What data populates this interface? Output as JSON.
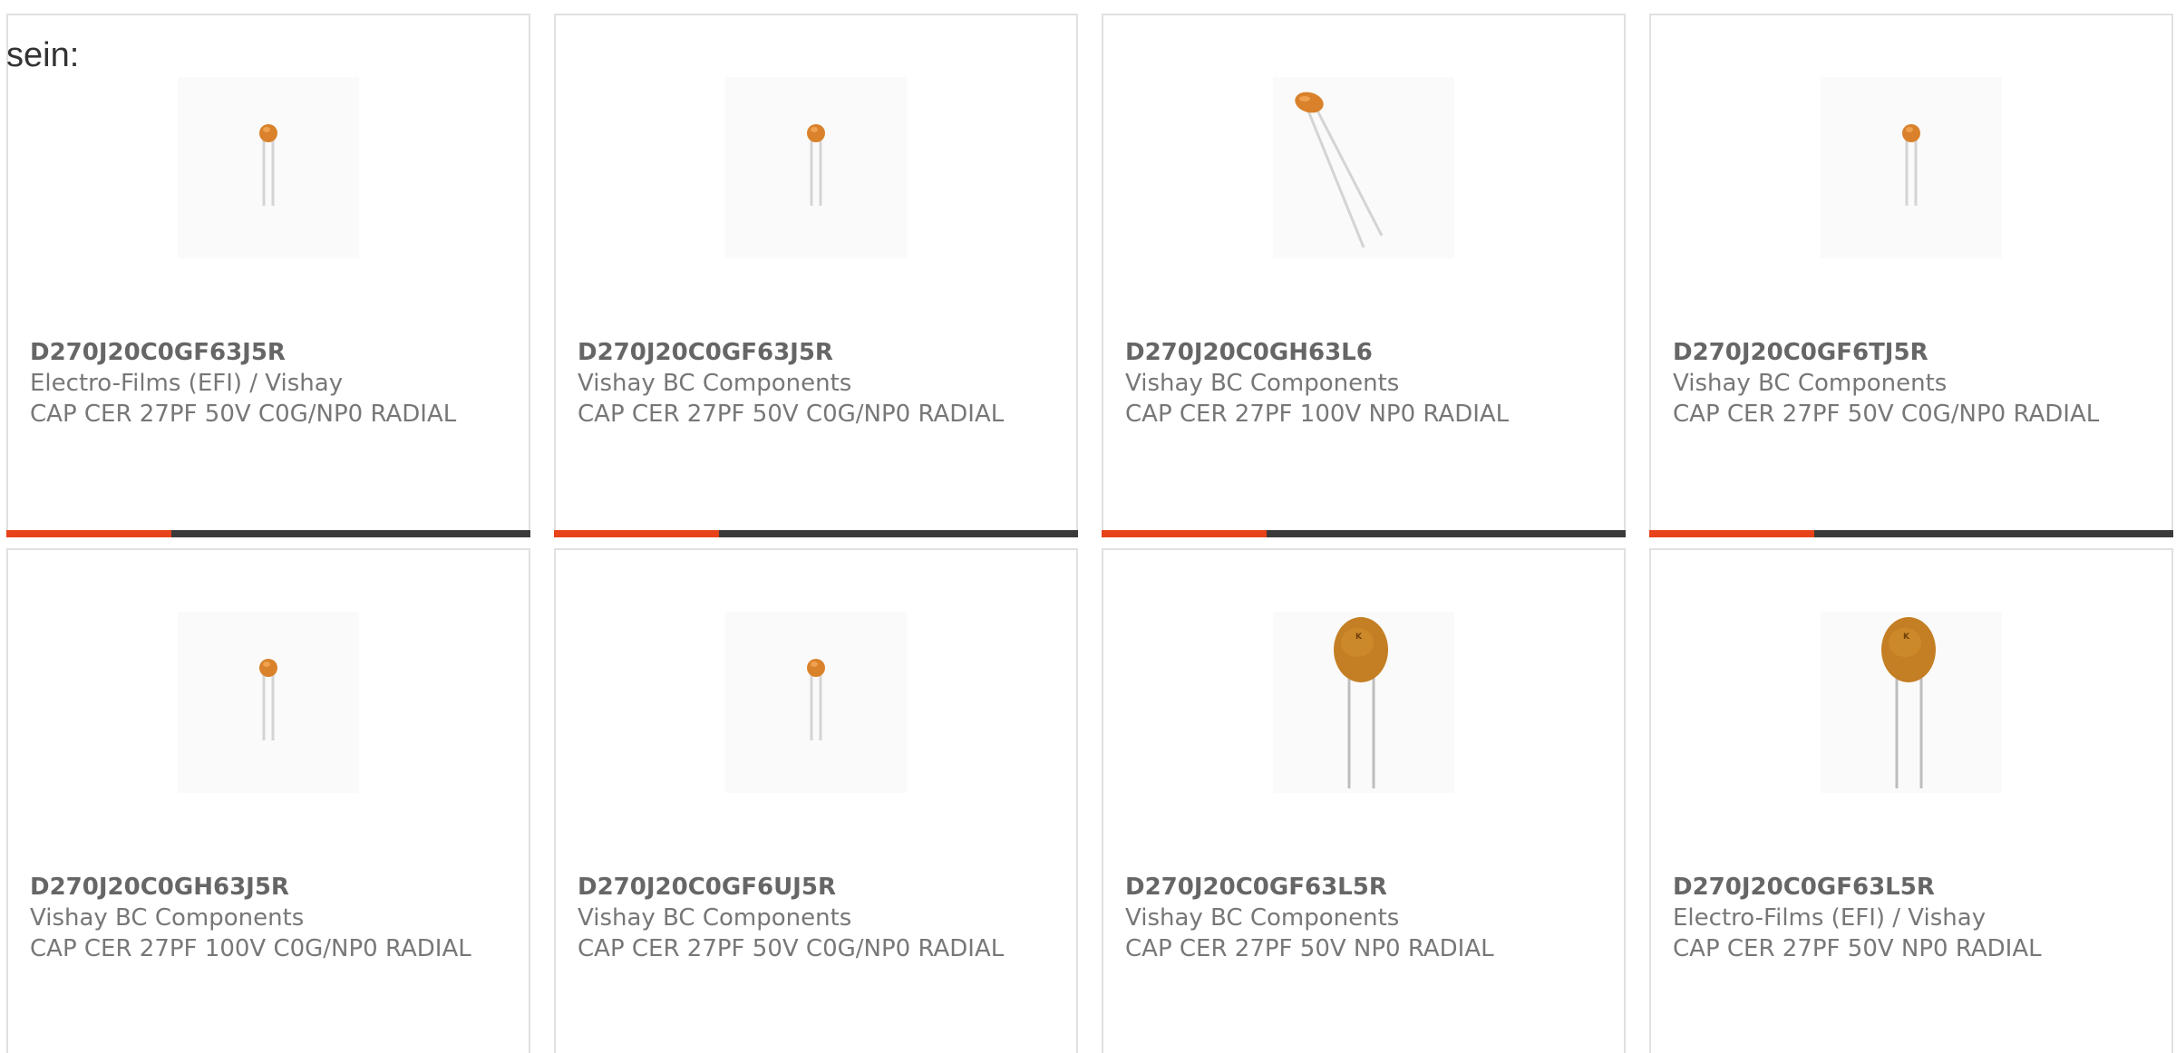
{
  "intro_text": "sein:",
  "colors": {
    "accent": "#e8421a",
    "bar_track": "#3a3a3a",
    "capacitor_body": "#d9822b"
  },
  "cards": [
    {
      "part_number": "D270J20C0GF63J5R",
      "manufacturer": "Electro-Films (EFI) / Vishay",
      "description": "CAP CER 27PF 50V C0G/NP0 RADIAL",
      "image": "small-radial-capacitor-icon",
      "progress": 0.315
    },
    {
      "part_number": "D270J20C0GF63J5R",
      "manufacturer": "Vishay BC Components",
      "description": "CAP CER 27PF 50V C0G/NP0 RADIAL",
      "image": "small-radial-capacitor-icon",
      "progress": 0.315
    },
    {
      "part_number": "D270J20C0GH63L6",
      "manufacturer": "Vishay BC Components",
      "description": "CAP CER 27PF 100V NP0 RADIAL",
      "image": "angled-radial-capacitor-icon",
      "progress": 0.315
    },
    {
      "part_number": "D270J20C0GF6TJ5R",
      "manufacturer": "Vishay BC Components",
      "description": "CAP CER 27PF 50V C0G/NP0 RADIAL",
      "image": "small-radial-capacitor-icon",
      "progress": 0.315
    },
    {
      "part_number": "D270J20C0GH63J5R",
      "manufacturer": "Vishay BC Components",
      "description": "CAP CER 27PF 100V C0G/NP0 RADIAL",
      "image": "small-radial-capacitor-icon",
      "progress": null
    },
    {
      "part_number": "D270J20C0GF6UJ5R",
      "manufacturer": "Vishay BC Components",
      "description": "CAP CER 27PF 50V C0G/NP0 RADIAL",
      "image": "small-radial-capacitor-icon",
      "progress": null
    },
    {
      "part_number": "D270J20C0GF63L5R",
      "manufacturer": "Vishay BC Components",
      "description": "CAP CER 27PF 50V NP0 RADIAL",
      "image": "disc-capacitor-icon",
      "progress": null
    },
    {
      "part_number": "D270J20C0GF63L5R",
      "manufacturer": "Electro-Films (EFI) / Vishay",
      "description": "CAP CER 27PF 50V NP0 RADIAL",
      "image": "disc-capacitor-icon",
      "progress": null
    }
  ]
}
